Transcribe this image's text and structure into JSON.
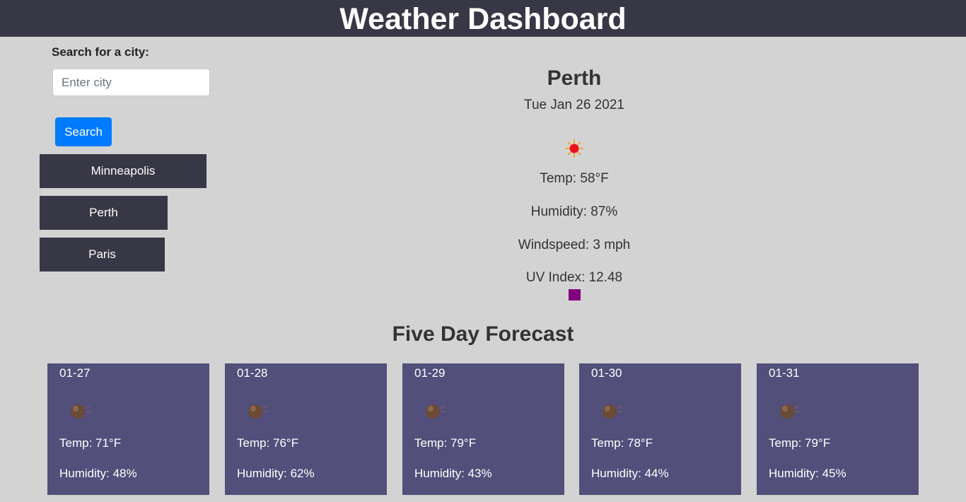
{
  "header": {
    "title": "Weather Dashboard"
  },
  "search": {
    "label": "Search for a city:",
    "placeholder": "Enter city",
    "button_label": "Search"
  },
  "history": [
    {
      "label": "Minneapolis"
    },
    {
      "label": "Perth"
    },
    {
      "label": "Paris"
    }
  ],
  "current": {
    "city": "Perth",
    "date": "Tue Jan 26 2021",
    "icon": "sun-icon",
    "temp": "Temp: 58°F",
    "humidity": "Humidity: 87%",
    "windspeed": "Windspeed: 3 mph",
    "uv": "UV Index: 12.48",
    "uv_color": "#800080"
  },
  "forecast": {
    "title": "Five Day Forecast",
    "days": [
      {
        "date": "01-27",
        "icon": "weather-icon",
        "temp": "Temp: 71°F",
        "humidity": "Humidity: 48%"
      },
      {
        "date": "01-28",
        "icon": "weather-icon",
        "temp": "Temp: 76°F",
        "humidity": "Humidity: 62%"
      },
      {
        "date": "01-29",
        "icon": "weather-icon",
        "temp": "Temp: 79°F",
        "humidity": "Humidity: 43%"
      },
      {
        "date": "01-30",
        "icon": "weather-icon",
        "temp": "Temp: 78°F",
        "humidity": "Humidity: 44%"
      },
      {
        "date": "01-31",
        "icon": "weather-icon",
        "temp": "Temp: 79°F",
        "humidity": "Humidity: 45%"
      }
    ]
  },
  "colors": {
    "header_bg": "#383746",
    "page_bg": "#d3d3d3",
    "button_blue": "#007bff",
    "card_bg": "#524f7a"
  }
}
